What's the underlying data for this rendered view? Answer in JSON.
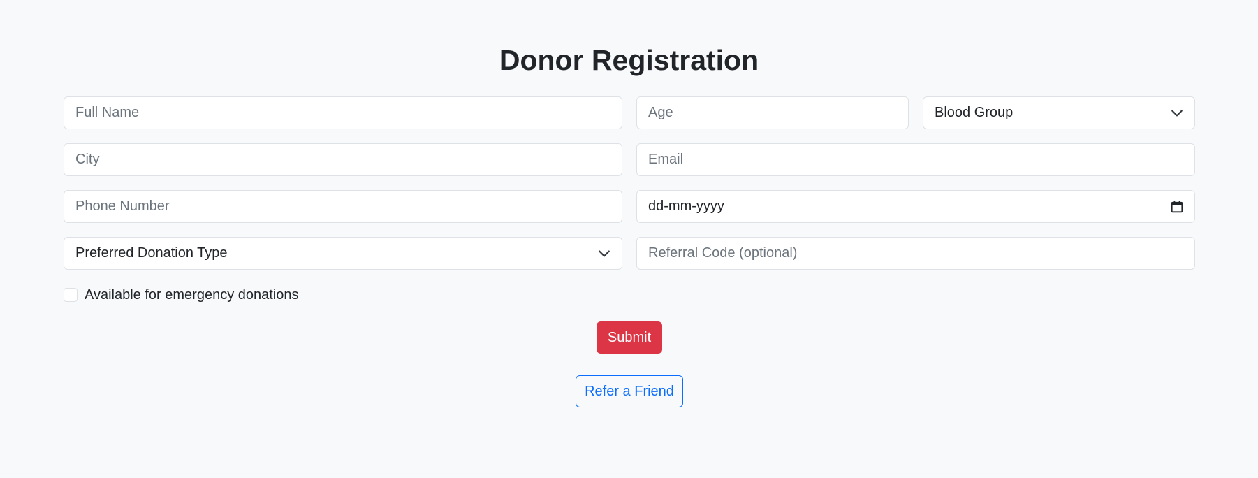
{
  "page": {
    "title": "Donor Registration"
  },
  "form": {
    "full_name_placeholder": "Full Name",
    "age_placeholder": "Age",
    "blood_group_selected": "Blood Group",
    "city_placeholder": "City",
    "email_placeholder": "Email",
    "phone_placeholder": "Phone Number",
    "date_value": "dd-mm-yyyy",
    "donation_type_selected": "Preferred Donation Type",
    "referral_placeholder": "Referral Code (optional)",
    "emergency_label": "Available for emergency donations",
    "emergency_checked": false
  },
  "buttons": {
    "submit_label": "Submit",
    "refer_label": "Refer a Friend"
  },
  "colors": {
    "submit_bg": "#dc3545",
    "refer_border": "#0d6efd",
    "background": "#f8f9fa"
  },
  "icons": {
    "select_chevron": "chevron-down-icon",
    "date_picker": "calendar-icon"
  }
}
